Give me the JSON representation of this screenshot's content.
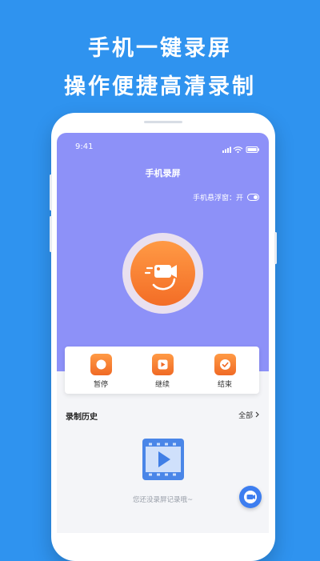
{
  "promo": {
    "line1": "手机一键录屏",
    "line2": "操作便捷高清录制"
  },
  "status_bar": {
    "time": "9:41",
    "icons": [
      "signal-icon",
      "wifi-icon",
      "battery-icon"
    ]
  },
  "app": {
    "title": "手机录屏",
    "floating_window_label": "手机悬浮窗：开",
    "floating_window_on": true
  },
  "record_button": {
    "icon": "video-camera-icon"
  },
  "controls": [
    {
      "label": "暂停",
      "icon": "pause-icon"
    },
    {
      "label": "继续",
      "icon": "play-icon"
    },
    {
      "label": "结束",
      "icon": "check-icon"
    }
  ],
  "history": {
    "title": "录制历史",
    "all_label": "全部",
    "all_icon": "chevron-right-icon",
    "empty_text": "您还没录屏记录哦~"
  },
  "colors": {
    "background": "#2f93ef",
    "header": "#8d91f8",
    "accent": "#f47a2e",
    "fab": "#3d7ef0"
  }
}
